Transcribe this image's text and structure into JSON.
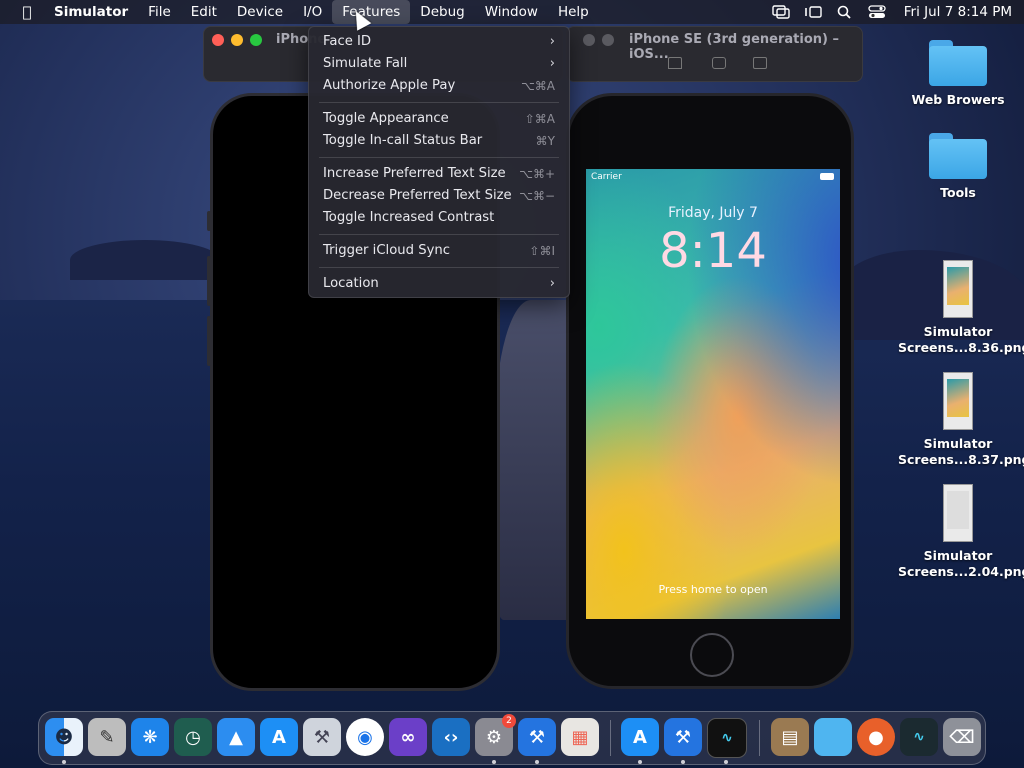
{
  "menubar": {
    "app": "Simulator",
    "menus": [
      "File",
      "Edit",
      "Device",
      "I/O",
      "Features",
      "Debug",
      "Window",
      "Help"
    ],
    "clock": "Fri Jul 7  8:14 PM"
  },
  "features_menu": {
    "items": [
      {
        "label": "Face ID",
        "shortcut": "",
        "submenu": true
      },
      {
        "label": "Simulate Fall",
        "shortcut": "",
        "submenu": true
      },
      {
        "label": "Authorize Apple Pay",
        "shortcut": "⌥⌘A",
        "submenu": false
      },
      {
        "label": "Toggle Appearance",
        "shortcut": "⇧⌘A",
        "submenu": false
      },
      {
        "label": "Toggle In-call Status Bar",
        "shortcut": "⌘Y",
        "submenu": false
      },
      {
        "label": "Increase Preferred Text Size",
        "shortcut": "⌥⌘+",
        "submenu": false
      },
      {
        "label": "Decrease Preferred Text Size",
        "shortcut": "⌥⌘−",
        "submenu": false
      },
      {
        "label": "Toggle Increased Contrast",
        "shortcut": "",
        "submenu": false
      },
      {
        "label": "Trigger iCloud Sync",
        "shortcut": "⇧⌘I",
        "submenu": false
      },
      {
        "label": "Location",
        "shortcut": "",
        "submenu": true
      }
    ]
  },
  "windows": {
    "left_title": "iPhone",
    "right_title": "iPhone SE (3rd generation) – iOS..."
  },
  "lockscreen": {
    "carrier": "Carrier",
    "date": "Friday, July 7",
    "time": "8:14",
    "hint": "Press home to open"
  },
  "desktop": {
    "items": [
      {
        "label": "Web Browers",
        "kind": "folder"
      },
      {
        "label": "Tools",
        "kind": "folder"
      },
      {
        "label1": "Simulator",
        "label2": "Screens...8.36.png",
        "kind": "image"
      },
      {
        "label1": "Simulator",
        "label2": "Screens...8.37.png",
        "kind": "image"
      },
      {
        "label1": "Simulator",
        "label2": "Screens...2.04.png",
        "kind": "doc"
      }
    ]
  },
  "dock": {
    "settings_badge": "2"
  },
  "colors": {
    "close": "#ff5f57",
    "minimize": "#febc2e",
    "zoom": "#28c840",
    "folder": "#4fb5f0"
  }
}
